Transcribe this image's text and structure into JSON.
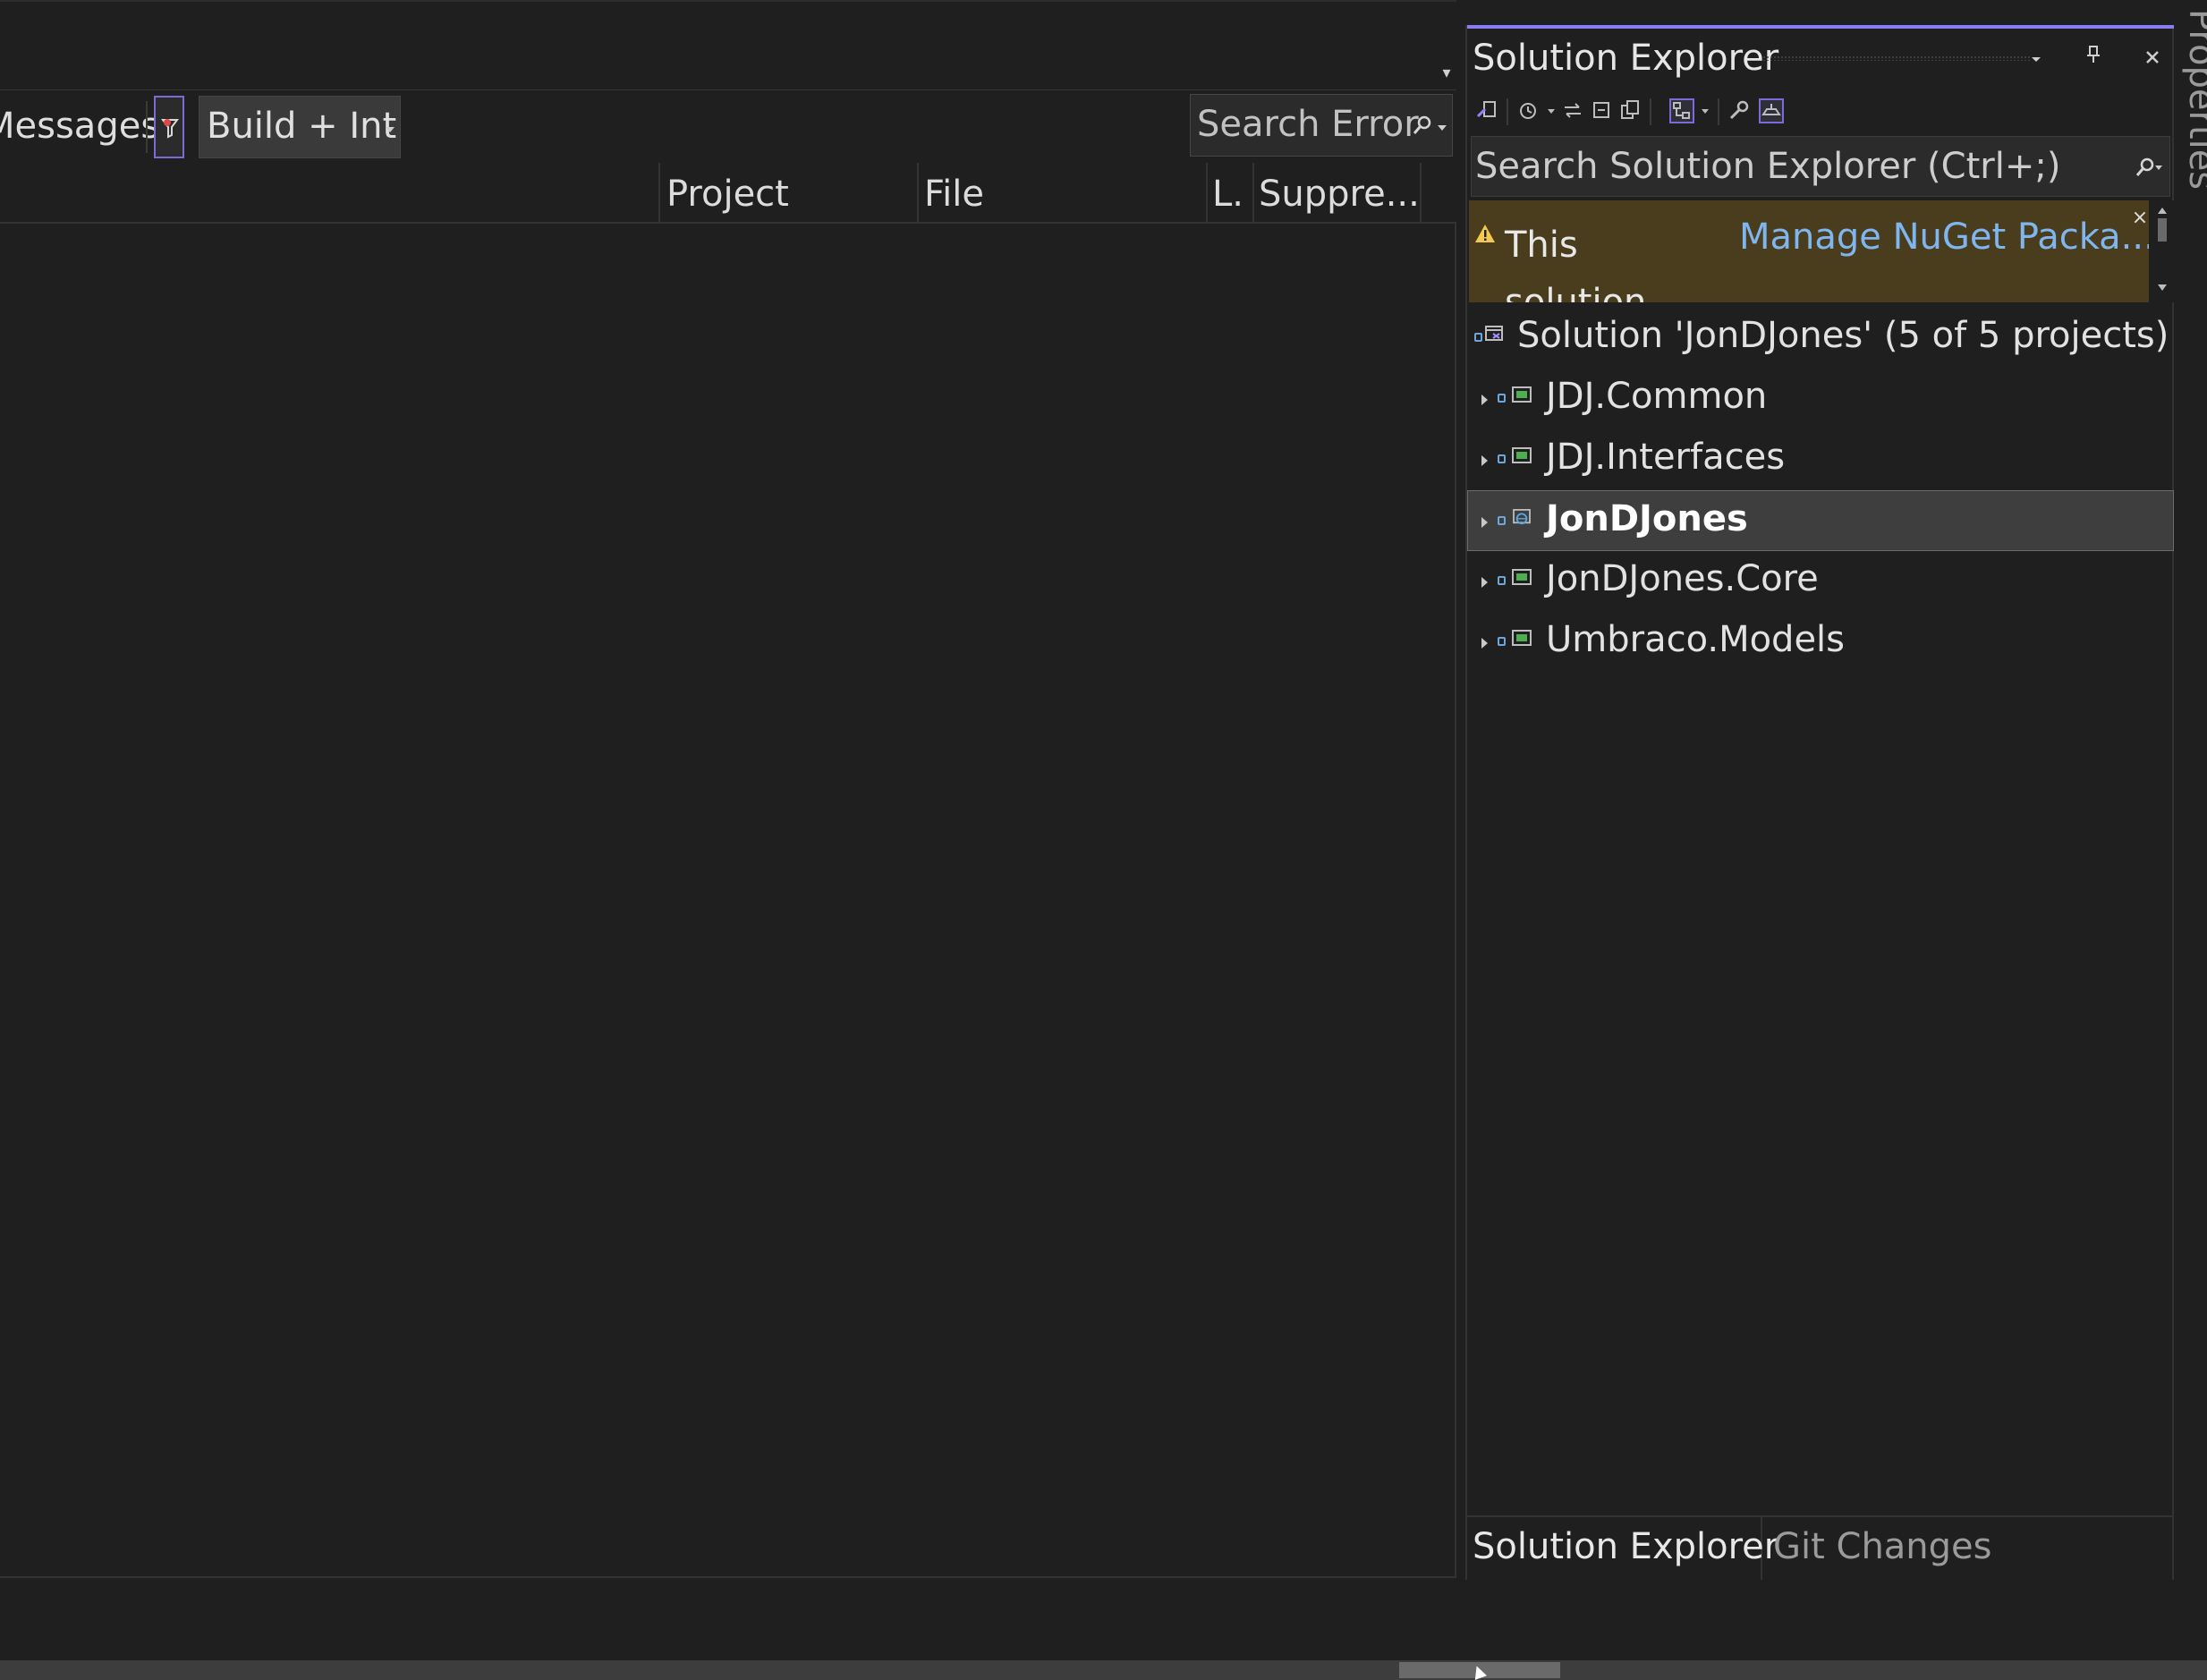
{
  "error_list": {
    "toolbar": {
      "messages_label": "Messages",
      "build_filter_label": "Build + Int",
      "search_placeholder": "Search Error"
    },
    "columns": [
      "Project",
      "File",
      "L.",
      "Suppre..."
    ]
  },
  "solution_explorer": {
    "title": "Solution Explorer",
    "search_placeholder": "Search Solution Explorer (Ctrl+;)",
    "banner": {
      "message": "This solution contains",
      "link": "Manage NuGet Packa..."
    },
    "tree": {
      "solution_label": "Solution 'JonDJones' (5 of 5 projects)",
      "projects": [
        {
          "label": "JDJ.Common",
          "icon": "csharp-library-icon"
        },
        {
          "label": "JDJ.Interfaces",
          "icon": "csharp-library-icon"
        },
        {
          "label": "JonDJones",
          "icon": "web-project-icon",
          "selected": true
        },
        {
          "label": "JonDJones.Core",
          "icon": "csharp-library-icon"
        },
        {
          "label": "Umbraco.Models",
          "icon": "csharp-library-icon"
        }
      ]
    },
    "tabs": [
      "Solution Explorer",
      "Git Changes"
    ]
  },
  "properties_tab_label": "Properties",
  "colors": {
    "background": "#1f1f1f",
    "accent": "#8b7cf0",
    "link": "#7fb6ef",
    "banner": "#4a3d1e"
  }
}
